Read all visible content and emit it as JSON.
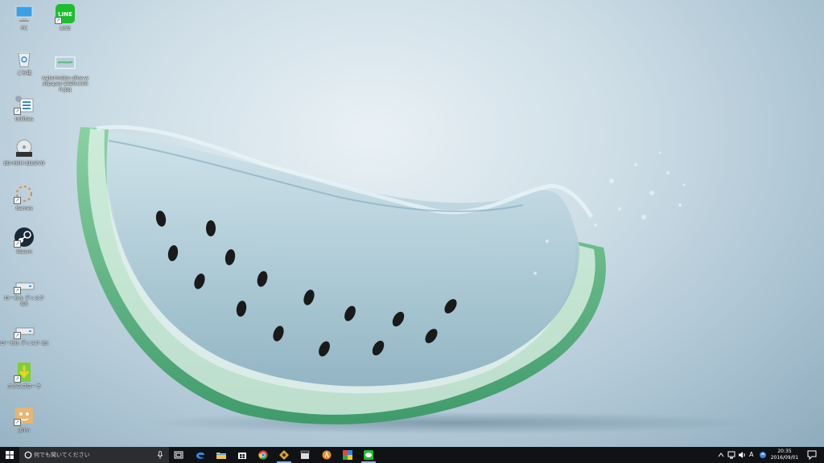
{
  "desktop_icons": [
    {
      "label": "PC"
    },
    {
      "label": "LINE"
    },
    {
      "label": "ごみ箱"
    },
    {
      "label": "watermelon slice-wallpaper-1920x1080.jpg"
    },
    {
      "label": "Utilities"
    },
    {
      "label": "BD-ROM BD/DVD"
    },
    {
      "label": "Games"
    },
    {
      "label": "Steam"
    },
    {
      "label": "ローカル ディスク (D)"
    },
    {
      "label": "ローカル ディスク (E)"
    },
    {
      "label": "エクスプローラ"
    },
    {
      "label": "Jtrim"
    }
  ],
  "taskbar": {
    "search_placeholder": "何でも聞いてください",
    "apps": [
      "task-view",
      "edge",
      "file-explorer",
      "store",
      "chrome",
      "app-badge",
      "movie-maker",
      "avast",
      "photo-app",
      "line"
    ],
    "tray": {
      "ime": "A",
      "time": "20:35",
      "date": "2016/09/01"
    }
  },
  "colors": {
    "taskbar_bg": "#101216",
    "rind": "#5fb87f",
    "seed": "#1a1a1a",
    "water": "#b9d4de"
  }
}
